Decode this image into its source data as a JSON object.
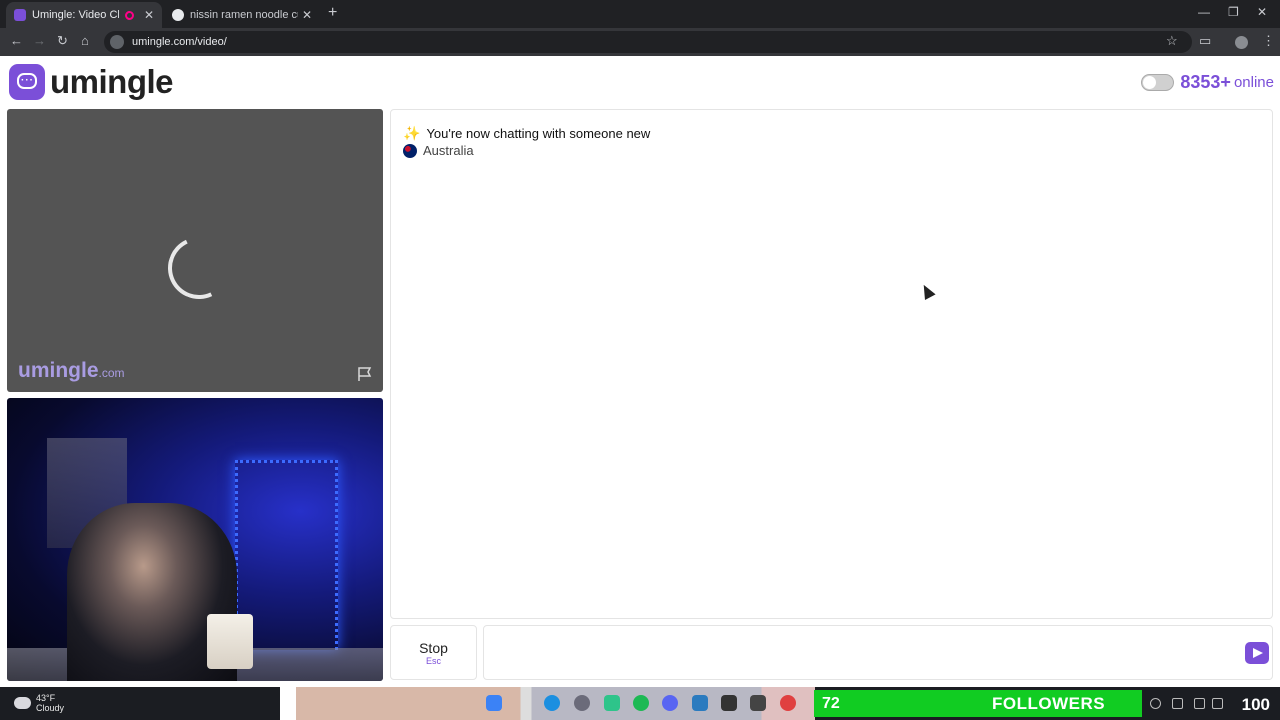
{
  "browser": {
    "tabs": [
      {
        "title": "Umingle: Video Chat with S",
        "active": true
      },
      {
        "title": "nissin ramen noodle cups - Goo",
        "active": false
      }
    ],
    "url": "umingle.com/video/"
  },
  "header": {
    "logo_text": "umingle",
    "online_count": "8353+",
    "online_label": "online"
  },
  "video": {
    "watermark_main": "umingle",
    "watermark_suffix": ".com"
  },
  "chat": {
    "status_message": "You're now chatting with someone new",
    "country": "Australia",
    "message_input_value": ""
  },
  "controls": {
    "stop_label": "Stop",
    "stop_hint": "Esc"
  },
  "taskbar": {
    "temperature": "43°F",
    "condition": "Cloudy",
    "followers_count": "72",
    "followers_label": "FOLLOWERS",
    "tray_value": "100"
  },
  "colors": {
    "brand": "#7b4fd8",
    "followers_green": "#11cc22"
  }
}
